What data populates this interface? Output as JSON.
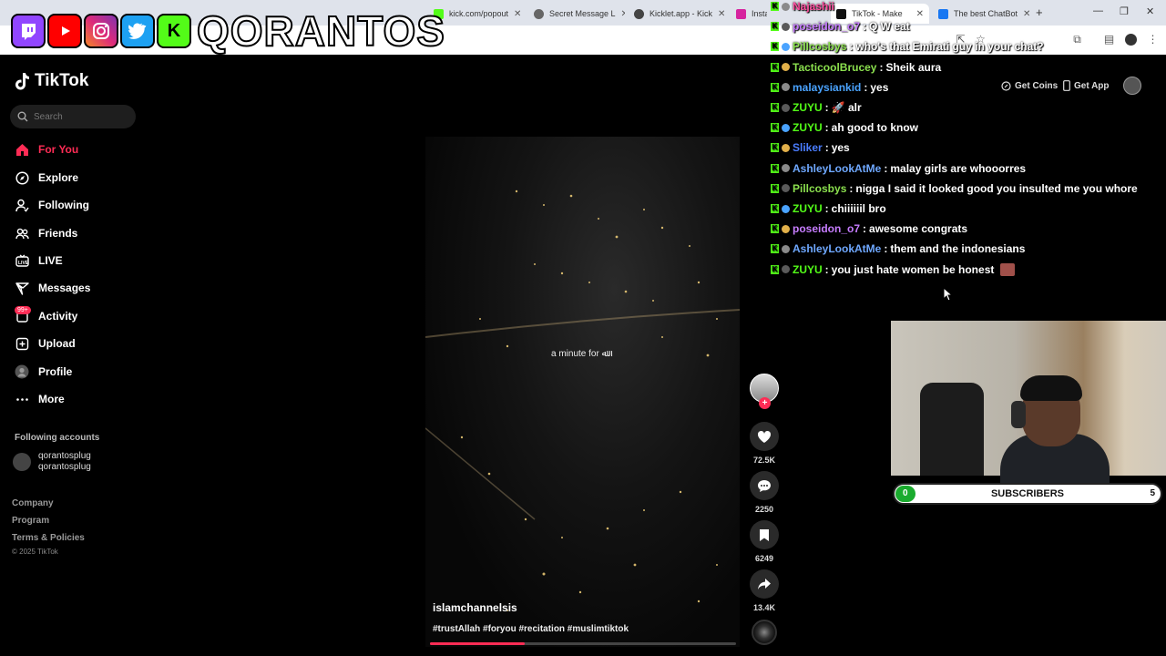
{
  "browser": {
    "tabs": [
      {
        "title": "",
        "favicon_color": "#e33"
      },
      {
        "title": "kick.com/popout",
        "favicon_color": "#53fc18"
      },
      {
        "title": "Secret Message L",
        "favicon_color": "#666"
      },
      {
        "title": "Kicklet.app - Kick",
        "favicon_color": "#444"
      },
      {
        "title": "Instagram • Mess",
        "favicon_color": "#d6249f"
      },
      {
        "title": "TikTok - Make",
        "favicon_color": "#111"
      },
      {
        "title": "The best ChatBot",
        "favicon_color": "#1877f2"
      }
    ],
    "newtab": "+",
    "controls": [
      "—",
      "❐",
      "✕"
    ]
  },
  "overlay": {
    "brand_name": "QORANTOS",
    "social_letters": [
      "",
      "",
      "",
      "",
      "K"
    ],
    "social_colors": [
      "#9146ff",
      "#ff0000",
      "#e1306c",
      "#1da1f2",
      "#53fc18"
    ]
  },
  "tiktok": {
    "logo": "TikTok",
    "search_placeholder": "Search",
    "nav": [
      {
        "label": "For You",
        "icon": "home-icon"
      },
      {
        "label": "Explore",
        "icon": "compass-icon"
      },
      {
        "label": "Following",
        "icon": "following-icon"
      },
      {
        "label": "Friends",
        "icon": "friends-icon"
      },
      {
        "label": "LIVE",
        "icon": "live-icon"
      },
      {
        "label": "Messages",
        "icon": "messages-icon"
      },
      {
        "label": "Activity",
        "icon": "activity-icon"
      },
      {
        "label": "Upload",
        "icon": "upload-icon"
      },
      {
        "label": "Profile",
        "icon": "profile-icon"
      },
      {
        "label": "More",
        "icon": "more-icon"
      }
    ],
    "activity_badge": "99+",
    "following_title": "Following accounts",
    "following_accounts": [
      {
        "name": "qorantosplug",
        "handle": "qorantosplug"
      }
    ],
    "footer": [
      "Company",
      "Program",
      "Terms & Policies"
    ],
    "copyright": "© 2025 TikTok",
    "get_coins": "Get Coins",
    "get_app": "Get App",
    "video": {
      "center_caption": "a minute for ﷲ",
      "author": "islamchannelsis",
      "tags": "#trustAllah #foryou #recitation #muslimtiktok",
      "progress": 0.31
    },
    "actions": {
      "likes": "72.5K",
      "comments": "2250",
      "saves": "6249",
      "shares": "13.4K"
    }
  },
  "chat": [
    {
      "user": "Najashii",
      "msg": "",
      "color": "#ff4fa0"
    },
    {
      "user": "poseidon_o7",
      "msg": "Q W eat",
      "color": "#c77dff"
    },
    {
      "user": "Pillcosbys",
      "msg": "who's that Emirati guy in your chat?",
      "color": "#8be04e"
    },
    {
      "user": "TacticoolBrucey",
      "msg": "Sheik aura",
      "color": "#8be04e"
    },
    {
      "user": "malaysiankid",
      "msg": "yes",
      "color": "#4aa3ff"
    },
    {
      "user": "ZUYU",
      "msg": "🚀 alr",
      "color": "#53fc18"
    },
    {
      "user": "ZUYU",
      "msg": "ah good to know",
      "color": "#53fc18"
    },
    {
      "user": "Sliker",
      "msg": "yes",
      "color": "#4a7dff"
    },
    {
      "user": "AshleyLookAtMe",
      "msg": "malay girls are whooorres",
      "color": "#6fa8ff"
    },
    {
      "user": "Pillcosbys",
      "msg": "nigga I said it looked good you insulted me you whore",
      "color": "#8be04e"
    },
    {
      "user": "ZUYU",
      "msg": "chiiiiiil bro",
      "color": "#53fc18"
    },
    {
      "user": "poseidon_o7",
      "msg": "awesome congrats",
      "color": "#c77dff"
    },
    {
      "user": "AshleyLookAtMe",
      "msg": "them and the indonesians",
      "color": "#6fa8ff"
    },
    {
      "user": "ZUYU",
      "msg": "you just hate women be honest",
      "color": "#53fc18"
    }
  ],
  "subscribers": {
    "label": "SUBSCRIBERS",
    "current": "0",
    "goal": "5",
    "progress": 0
  }
}
